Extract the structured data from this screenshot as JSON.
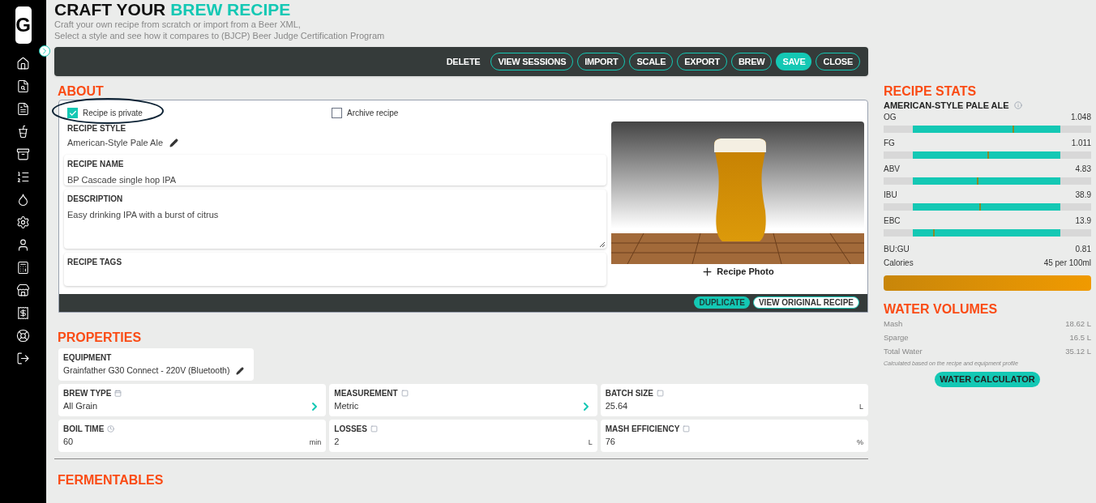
{
  "header": {
    "title_plain": "CRAFT YOUR",
    "title_accent": "BREW RECIPE",
    "subtitle_lines": [
      "Craft your own recipe from scratch or import from a Beer XML,",
      "Select a style and see how it compares to (BJCP) Beer Judge Certification Program"
    ]
  },
  "sidebar": {
    "logo": "G"
  },
  "toolbar": {
    "buttons": [
      {
        "label": "DELETE",
        "kind": "plain"
      },
      {
        "label": "VIEW SESSIONS",
        "kind": "outline"
      },
      {
        "label": "IMPORT",
        "kind": "outline"
      },
      {
        "label": "SCALE",
        "kind": "outline"
      },
      {
        "label": "EXPORT",
        "kind": "outline"
      },
      {
        "label": "BREW",
        "kind": "outline"
      },
      {
        "label": "SAVE",
        "kind": "filled"
      },
      {
        "label": "CLOSE",
        "kind": "outline"
      }
    ]
  },
  "about": {
    "heading": "ABOUT",
    "checkboxes": [
      {
        "label": "Recipe is private",
        "checked": true
      },
      {
        "label": "Archive recipe",
        "checked": false
      }
    ],
    "style": {
      "label": "RECIPE STYLE",
      "value": "American-Style Pale Ale"
    },
    "fields": [
      {
        "label": "RECIPE NAME",
        "value": "BP Cascade single hop IPA",
        "kind": "input"
      },
      {
        "label": "DESCRIPTION",
        "value": "Easy drinking IPA with a burst of citrus",
        "kind": "textarea"
      },
      {
        "label": "RECIPE TAGS",
        "kind": "tags"
      }
    ],
    "photo_label": "Recipe Photo",
    "footer_buttons": [
      {
        "label": "DUPLICATE",
        "kind": "filled"
      },
      {
        "label": "VIEW ORIGINAL RECIPE",
        "kind": "outline"
      }
    ]
  },
  "properties": {
    "heading": "PROPERTIES",
    "equipment": {
      "label": "EQUIPMENT",
      "value": "Grainfather G30 Connect - 220V (Bluetooth)"
    },
    "fields": [
      {
        "label": "BREW TYPE",
        "value": "All Grain",
        "kind": "select"
      },
      {
        "label": "MEASUREMENT",
        "value": "Metric",
        "kind": "select"
      },
      {
        "label": "BATCH SIZE",
        "value": "25.64",
        "unit": "L",
        "kind": "number"
      },
      {
        "label": "BOIL TIME",
        "value": "60",
        "unit": "min",
        "kind": "number"
      },
      {
        "label": "LOSSES",
        "value": "2",
        "unit": "L",
        "kind": "number"
      },
      {
        "label": "MASH EFFICIENCY",
        "value": "76",
        "unit": "%",
        "kind": "number"
      }
    ]
  },
  "fermentables": {
    "heading": "FERMENTABLES"
  },
  "recipe_stats": {
    "heading": "RECIPE STATS",
    "style_name": "AMERICAN-STYLE PALE ALE",
    "meters": [
      {
        "name": "OG",
        "value": "1.048",
        "level": 0.62
      },
      {
        "name": "FG",
        "value": "1.011",
        "level": 0.5
      },
      {
        "name": "ABV",
        "value": "4.83",
        "level": 0.45
      },
      {
        "name": "IBU",
        "value": "38.9",
        "level": 0.46
      },
      {
        "name": "EBC",
        "value": "13.9",
        "level": 0.24
      }
    ],
    "rows": [
      {
        "name": "BU:GU",
        "value": "0.81"
      },
      {
        "name": "Calories",
        "value": "45 per 100ml"
      }
    ]
  },
  "water_volumes": {
    "heading": "WATER VOLUMES",
    "rows": [
      {
        "name": "Mash",
        "value": "18.62 L"
      },
      {
        "name": "Sparge",
        "value": "16.5 L"
      },
      {
        "name": "Total Water",
        "value": "35.12 L"
      }
    ],
    "note": "Calculated based on the recipe and equipment profile",
    "button": "WATER CALCULATOR"
  }
}
